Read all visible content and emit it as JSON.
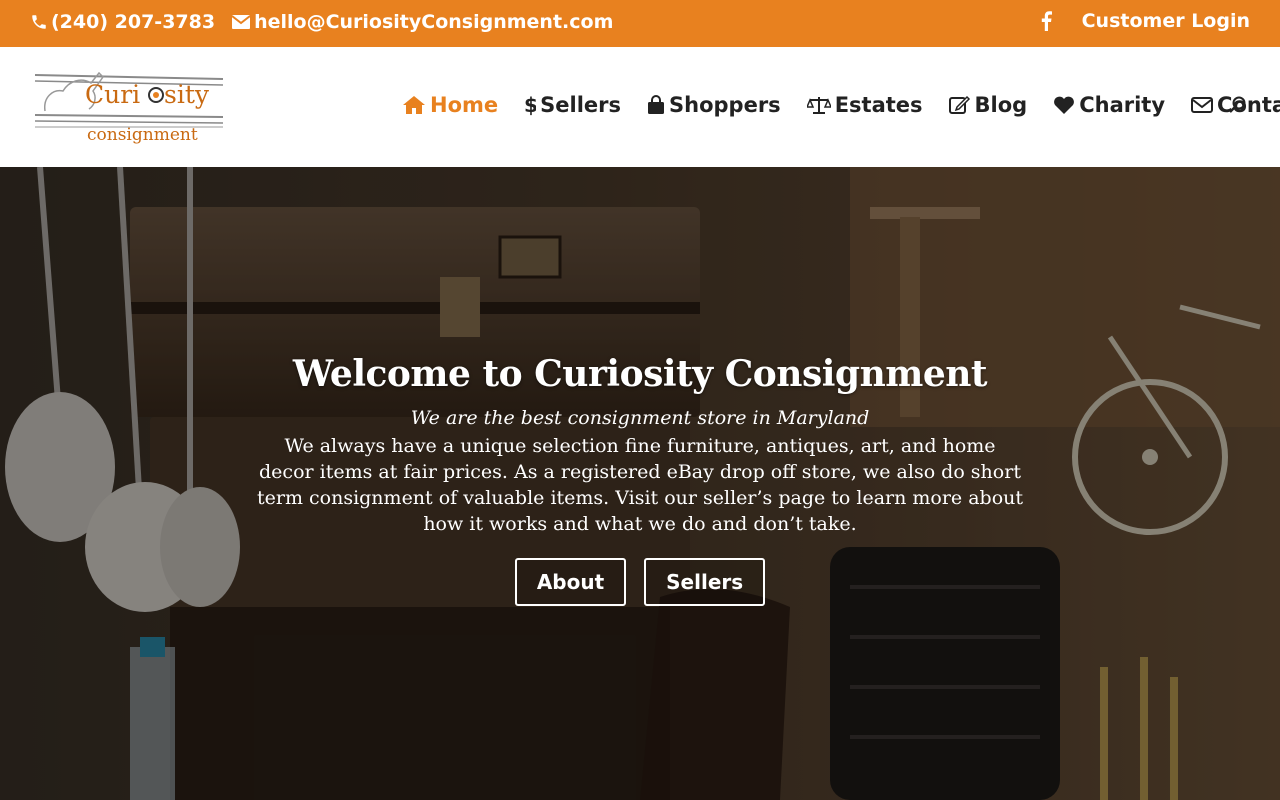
{
  "topbar": {
    "phone": "(240) 207-3783",
    "email": "hello@CuriosityConsignment.com",
    "login": "Customer Login",
    "icons": [
      "phone-icon",
      "envelope-icon",
      "facebook-icon"
    ],
    "color": "#e8811f"
  },
  "logo": {
    "word1": "Curi",
    "word1b": "sity",
    "word2": "consignment"
  },
  "nav": {
    "items": [
      {
        "label": "Home",
        "icon": "home-icon"
      },
      {
        "label": "Sellers",
        "icon": "dollar-icon"
      },
      {
        "label": "Shoppers",
        "icon": "shopping-bag-icon"
      },
      {
        "label": "Estates",
        "icon": "scales-icon"
      },
      {
        "label": "Blog",
        "icon": "edit-icon"
      },
      {
        "label": "Charity",
        "icon": "heart-icon"
      },
      {
        "label": "Contact",
        "icon": "envelope-icon"
      }
    ],
    "active": "Home",
    "search_icon": "search-icon"
  },
  "hero": {
    "title": "Welcome to Curiosity Consignment",
    "subtitle": "We are the best consignment store in Maryland",
    "body": "We always have a unique selection fine furniture, antiques, art, and home decor items at fair prices.  As a registered eBay drop off store, we also do short term consignment of valuable items. Visit our seller’s page to learn more about how it works and what we do and don’t take.",
    "buttons": [
      "About",
      "Sellers"
    ]
  }
}
